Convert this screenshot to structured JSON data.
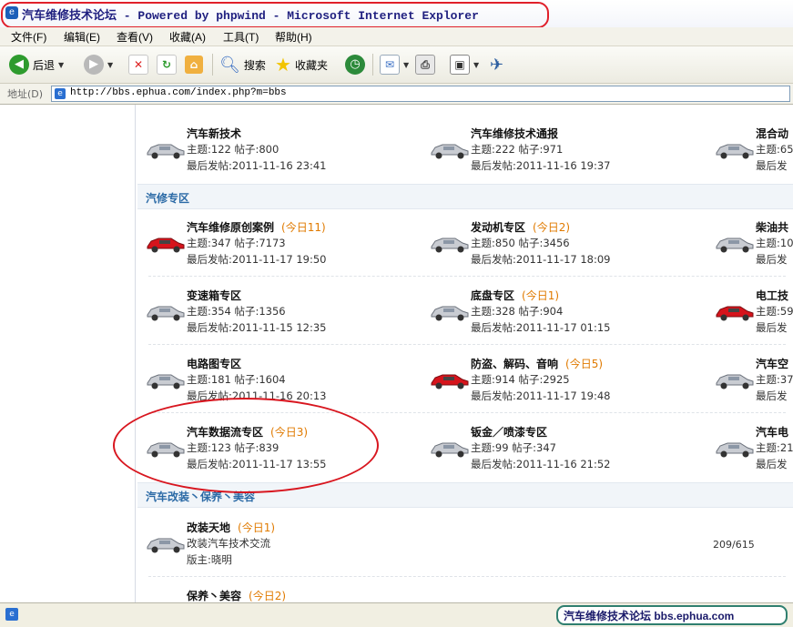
{
  "window": {
    "title": "汽车维修技术论坛 - Powered by phpwind - Microsoft Internet Explorer"
  },
  "menu": [
    "文件(F)",
    "编辑(E)",
    "查看(V)",
    "收藏(A)",
    "工具(T)",
    "帮助(H)"
  ],
  "toolbar": {
    "back_label": "后退",
    "search_label": "搜索",
    "favorites_label": "收藏夹"
  },
  "address": {
    "label": "地址(D)",
    "url": "http://bbs.ephua.com/index.php?m=bbs"
  },
  "forums_top": [
    {
      "name": "汽车新技术",
      "today": "",
      "stats": "主题:122   帖子:800",
      "last": "最后发帖:2011-11-16 23:41",
      "car": "silver"
    },
    {
      "name": "汽车维修技术通报",
      "today": "",
      "stats": "主题:222   帖子:971",
      "last": "最后发帖:2011-11-16 19:37",
      "car": "silver"
    },
    {
      "name": "混合动",
      "today": "",
      "stats": "主题:65",
      "last": "最后发",
      "car": "silver"
    }
  ],
  "sections": [
    {
      "title": "汽修专区"
    },
    {
      "title": "汽车改装丶保养丶美容"
    }
  ],
  "forums_repair": [
    {
      "name": "汽车维修原创案例",
      "today": "(今日11)",
      "stats": "主题:347   帖子:7173",
      "last": "最后发帖:2011-11-17 19:50",
      "car": "red"
    },
    {
      "name": "发动机专区",
      "today": "(今日2)",
      "stats": "主题:850   帖子:3456",
      "last": "最后发帖:2011-11-17 18:09",
      "car": "silver"
    },
    {
      "name": "柴油共",
      "today": "",
      "stats": "主题:10",
      "last": "最后发",
      "car": "silver"
    },
    {
      "name": "变速箱专区",
      "today": "",
      "stats": "主题:354   帖子:1356",
      "last": "最后发帖:2011-11-15 12:35",
      "car": "silver"
    },
    {
      "name": "底盘专区",
      "today": "(今日1)",
      "stats": "主题:328   帖子:904",
      "last": "最后发帖:2011-11-17 01:15",
      "car": "silver"
    },
    {
      "name": "电工技",
      "today": "",
      "stats": "主题:59",
      "last": "最后发",
      "car": "red"
    },
    {
      "name": "电路图专区",
      "today": "",
      "stats": "主题:181   帖子:1604",
      "last": "最后发帖:2011-11-16 20:13",
      "car": "silver"
    },
    {
      "name": "防盗、解码、音响",
      "today": "(今日5)",
      "stats": "主题:914   帖子:2925",
      "last": "最后发帖:2011-11-17 19:48",
      "car": "red"
    },
    {
      "name": "汽车空",
      "today": "",
      "stats": "主题:37",
      "last": "最后发",
      "car": "silver"
    },
    {
      "name": "汽车数据流专区",
      "today": "(今日3)",
      "stats": "主题:123   帖子:839",
      "last": "最后发帖:2011-11-17 13:55",
      "car": "silver"
    },
    {
      "name": "钣金／喷漆专区",
      "today": "",
      "stats": "主题:99   帖子:347",
      "last": "最后发帖:2011-11-16 21:52",
      "car": "silver"
    },
    {
      "name": "汽车电",
      "today": "",
      "stats": "主题:21",
      "last": "最后发",
      "car": "silver"
    }
  ],
  "forums_mod": [
    {
      "name": "改装天地",
      "today": "(今日1)",
      "desc": "改装汽车技术交流",
      "moderator": "版主:晓明",
      "counts": "209/615",
      "car": "silver"
    },
    {
      "name": "保养丶美容",
      "today": "(今日2)",
      "car": "silver"
    }
  ],
  "status": {
    "text": "汽车维修技术论坛 bbs.ephua.com"
  },
  "colors": {
    "section_title": "#2b6aa6",
    "today": "#e07a00",
    "annotation_red": "#d8161f"
  }
}
